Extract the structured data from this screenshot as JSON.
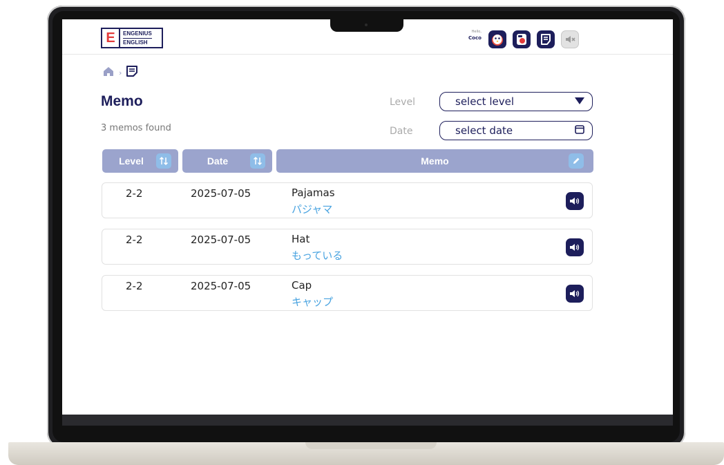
{
  "header": {
    "logo_line1": "ENGENIUS",
    "logo_line2": "ENGLISH",
    "logo_letter": "E",
    "greeting": "Hello,",
    "username": "Coco",
    "icons": [
      "penguin-avatar-icon",
      "record-icon",
      "memo-icon",
      "mute-icon"
    ]
  },
  "breadcrumb": {
    "icons": [
      "home-icon",
      "memo-icon"
    ],
    "separator": "›"
  },
  "page": {
    "title": "Memo",
    "count_text": "3 memos found"
  },
  "filters": {
    "level_label": "Level",
    "level_placeholder": "select level",
    "date_label": "Date",
    "date_placeholder": "select date"
  },
  "table": {
    "headers": {
      "level": "Level",
      "date": "Date",
      "memo": "Memo"
    },
    "rows": [
      {
        "level": "2-2",
        "date": "2025-07-05",
        "word": "Pajamas",
        "translation": "パジャマ"
      },
      {
        "level": "2-2",
        "date": "2025-07-05",
        "word": "Hat",
        "translation": "もっている"
      },
      {
        "level": "2-2",
        "date": "2025-07-05",
        "word": "Cap",
        "translation": "キャップ"
      }
    ]
  },
  "colors": {
    "navy": "#1d1e5b",
    "header_bg": "#9ba4cd",
    "accent_blue": "#49a3e0",
    "logo_red": "#e23b3b"
  }
}
